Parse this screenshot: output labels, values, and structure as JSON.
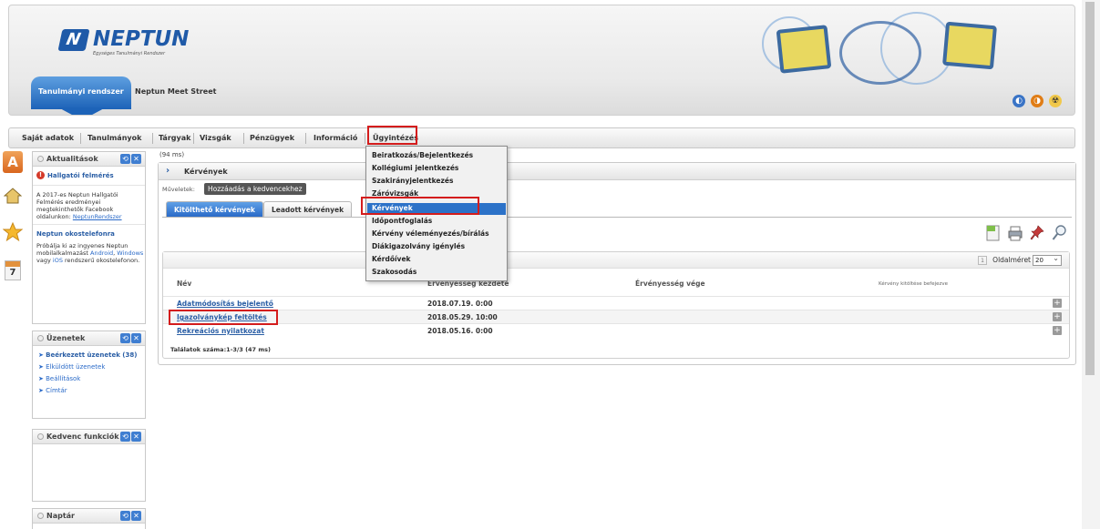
{
  "header": {
    "logo_name": "NEPTUN",
    "logo_tagline": "Egységes Tanulmányi Rendszer",
    "system_tab": "Tanulmányi rendszer",
    "meet_street": "Neptun Meet Street"
  },
  "menu": {
    "items": [
      "Saját adatok",
      "Tanulmányok",
      "Tárgyak",
      "Vizsgák",
      "Pénzügyek",
      "Információ",
      "Ügyintézés"
    ]
  },
  "dropdown": {
    "items": [
      "Beiratkozás/Bejelentkezés",
      "Kollégiumi jelentkezés",
      "Szakirányjelentkezés",
      "Záróvizsgák",
      "Kérvények",
      "Időpontfoglalás",
      "Kérvény véleményezés/bírálás",
      "Diákigazolvány igénylés",
      "Kérdőívek",
      "Szakosodás"
    ],
    "selected": "Kérvények"
  },
  "sidebar": {
    "aktualitasok": {
      "title": "Aktualitások",
      "survey_title": "Hallgatói felmérés",
      "survey_text": "A 2017-es Neptun Hallgatói Felmérés eredményei megtekinthetők Facebook oldalunkon:",
      "survey_link": "NeptunRendszer",
      "app_title": "Neptun okostelefonra",
      "app_text_1": "Próbálja ki az ingyenes Neptun mobilalkalmazást",
      "app_android": "Android",
      "app_windows": "Windows",
      "app_vagy": "vagy",
      "app_ios": "iOS",
      "app_text_2": "rendszerű okostelefonon."
    },
    "uzenetek": {
      "title": "Üzenetek",
      "items": [
        "Beérkezett üzenetek (38)",
        "Elküldött üzenetek",
        "Beállítások",
        "Címtár"
      ]
    },
    "kedvenc": {
      "title": "Kedvenc funkciók"
    },
    "naptar": {
      "title": "Naptár"
    }
  },
  "main": {
    "timing": "(94 ms)",
    "panel_title": "Kérvények",
    "ops_label": "Műveletek:",
    "fav_button": "Hozzáadás a kedvencekhez",
    "tabs": [
      "Kitölthető kérvények",
      "Leadott kérvények"
    ],
    "page_number": "1",
    "page_size_label": "Oldalméret",
    "page_size_value": "20",
    "columns": [
      "Név",
      "Érvényesség kezdete",
      "Érvényesség vége",
      "Kérvény kitöltése befejezve"
    ],
    "rows": [
      {
        "name": "Adatmódosítás bejelentő",
        "start": "2018.07.19. 0:00"
      },
      {
        "name": "Igazolványkép feltöltés",
        "start": "2018.05.29. 10:00"
      },
      {
        "name": "Rekreációs nyilatkozat",
        "start": "2018.05.16. 0:00"
      }
    ],
    "found": "Találatok száma:1-3/3 (47 ms)"
  },
  "colors": {
    "brand_blue": "#1f5aa8",
    "highlight_red": "#d41c1c",
    "link_blue": "#2a5ea5",
    "selected_blue": "#2c72c8"
  }
}
